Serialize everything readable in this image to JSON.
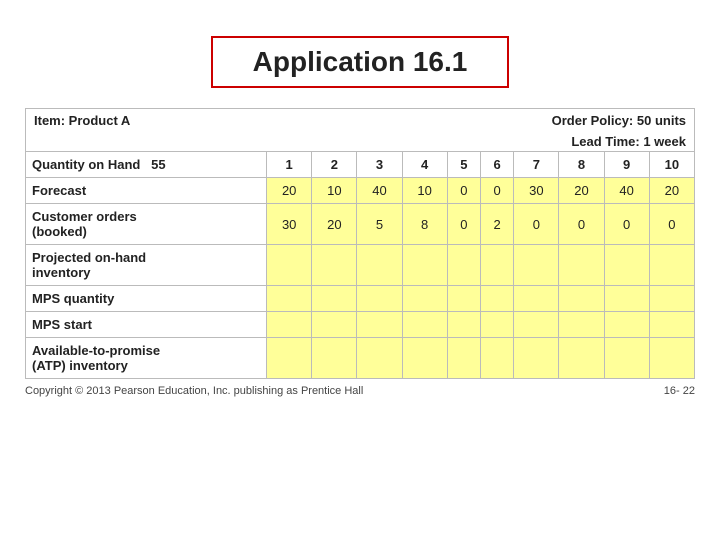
{
  "title": "Application 16.1",
  "item": "Item: Product A",
  "order_policy": "Order Policy: 50 units",
  "lead_time": "Lead Time: 1 week",
  "columns": [
    "",
    "55",
    "1",
    "2",
    "3",
    "4",
    "5",
    "6",
    "7",
    "8",
    "9",
    "10"
  ],
  "rows": [
    {
      "label": "Quantity on Hand",
      "label_suffix": "  55",
      "values": [
        "",
        "1",
        "2",
        "3",
        "4",
        "5",
        "6",
        "7",
        "8",
        "9",
        "10"
      ]
    },
    {
      "label": "Forecast",
      "values": [
        "20",
        "10",
        "40",
        "10",
        "0",
        "0",
        "30",
        "20",
        "40",
        "20"
      ]
    },
    {
      "label": "Customer orders\n(booked)",
      "values": [
        "30",
        "20",
        "5",
        "8",
        "0",
        "2",
        "0",
        "0",
        "0",
        "0"
      ]
    },
    {
      "label": "Projected on-hand\ninventory",
      "values": [
        "",
        "",
        "",
        "",
        "",
        "",
        "",
        "",
        "",
        ""
      ]
    },
    {
      "label": "MPS quantity",
      "values": [
        "",
        "",
        "",
        "",
        "",
        "",
        "",
        "",
        "",
        ""
      ]
    },
    {
      "label": "MPS start",
      "values": [
        "",
        "",
        "",
        "",
        "",
        "",
        "",
        "",
        "",
        ""
      ]
    },
    {
      "label": "Available-to-promise\n(ATP) inventory",
      "values": [
        "",
        "",
        "",
        "",
        "",
        "",
        "",
        "",
        "",
        ""
      ]
    }
  ],
  "footer_left": "Copyright © 2013 Pearson Education, Inc. publishing as Prentice Hall",
  "footer_right": "16- 22"
}
